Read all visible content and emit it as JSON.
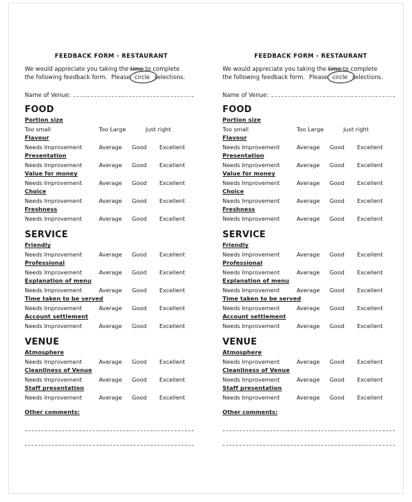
{
  "document": {
    "title": "FEEDBACK FORM - RESTAURANT",
    "intro_line_1_a": "We would appreciate you taking the ",
    "intro_line_1_time": "time",
    "intro_line_1_b": " to complete",
    "intro_line_2_a": "the following feedback form.",
    "intro_line_2_please": "Please",
    "intro_line_2_circle": "circle",
    "intro_line_2_b": "selections.",
    "venue_label": "Name of Venue:",
    "other_comments_label": "Other comments:"
  },
  "scales": {
    "size": [
      "Too small",
      "Too Large",
      "Just right"
    ],
    "quality": [
      "Needs Improvement",
      "Average",
      "Good",
      "Excellent"
    ]
  },
  "sections": [
    {
      "heading": "FOOD",
      "items": [
        {
          "label": "Portion size",
          "scale": "size"
        },
        {
          "label": "Flavour",
          "scale": "quality"
        },
        {
          "label": "Presentation",
          "scale": "quality"
        },
        {
          "label": "Value for money",
          "scale": "quality"
        },
        {
          "label": "Choice",
          "scale": "quality"
        },
        {
          "label": "Freshness",
          "scale": "quality"
        }
      ]
    },
    {
      "heading": "SERVICE",
      "items": [
        {
          "label": "Friendly",
          "scale": "quality"
        },
        {
          "label": "Professional",
          "scale": "quality"
        },
        {
          "label": "Explanation of menu",
          "scale": "quality"
        },
        {
          "label": "Time taken to be served",
          "scale": "quality"
        },
        {
          "label": "Account settlement",
          "scale": "quality"
        }
      ]
    },
    {
      "heading": "VENUE",
      "items": [
        {
          "label": "Atmosphere",
          "scale": "quality"
        },
        {
          "label": "Cleanliness of Venue",
          "scale": "quality"
        },
        {
          "label": "Staff presentation",
          "scale": "quality"
        }
      ]
    }
  ],
  "comment_lines": 2,
  "copies": 2,
  "colors": {
    "text": "#1a1a1a",
    "rule": "#8d8d8d",
    "page_border": "#e2e2e2"
  }
}
